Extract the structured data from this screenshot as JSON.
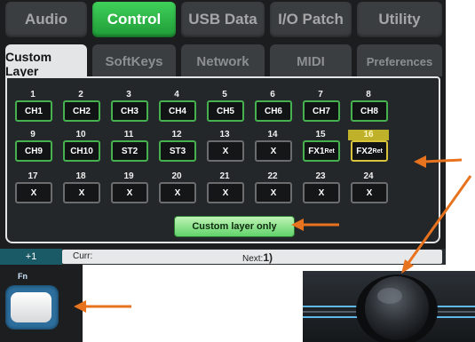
{
  "top_tabs": [
    {
      "label": "Audio",
      "active": false
    },
    {
      "label": "Control",
      "active": true
    },
    {
      "label": "USB Data",
      "active": false
    },
    {
      "label": "I/O Patch",
      "active": false
    },
    {
      "label": "Utility",
      "active": false
    }
  ],
  "sub_tabs": [
    {
      "label": "Custom Layer",
      "active": true
    },
    {
      "label": "SoftKeys",
      "active": false
    },
    {
      "label": "Network",
      "active": false
    },
    {
      "label": "MIDI",
      "active": false
    },
    {
      "label": "Preferences",
      "active": false
    }
  ],
  "strips": [
    {
      "num": "1",
      "label": "CH1"
    },
    {
      "num": "2",
      "label": "CH2"
    },
    {
      "num": "3",
      "label": "CH3"
    },
    {
      "num": "4",
      "label": "CH4"
    },
    {
      "num": "5",
      "label": "CH5"
    },
    {
      "num": "6",
      "label": "CH6"
    },
    {
      "num": "7",
      "label": "CH7"
    },
    {
      "num": "8",
      "label": "CH8"
    },
    {
      "num": "9",
      "label": "CH9"
    },
    {
      "num": "10",
      "label": "CH10"
    },
    {
      "num": "11",
      "label": "ST2"
    },
    {
      "num": "12",
      "label": "ST3"
    },
    {
      "num": "13",
      "label": "X"
    },
    {
      "num": "14",
      "label": "X"
    },
    {
      "num": "15",
      "label": "FX1",
      "sub": "Ret"
    },
    {
      "num": "16",
      "label": "FX2",
      "sub": "Ret",
      "selected": true
    },
    {
      "num": "17",
      "label": "X"
    },
    {
      "num": "18",
      "label": "X"
    },
    {
      "num": "19",
      "label": "X"
    },
    {
      "num": "20",
      "label": "X"
    },
    {
      "num": "21",
      "label": "X"
    },
    {
      "num": "22",
      "label": "X"
    },
    {
      "num": "23",
      "label": "X"
    },
    {
      "num": "24",
      "label": "X"
    }
  ],
  "custom_layer_button": "Custom layer only",
  "status": {
    "offset": "+1",
    "curr": "Curr:",
    "next_label": "Next:",
    "next_value": "1)"
  },
  "fn_key": {
    "label": "Fn"
  },
  "colors": {
    "active_tab": "#2fbf47",
    "accent_arrow": "#e8731f",
    "assigned_border": "#46b14f",
    "selected_highlight": "#bfb12a"
  }
}
